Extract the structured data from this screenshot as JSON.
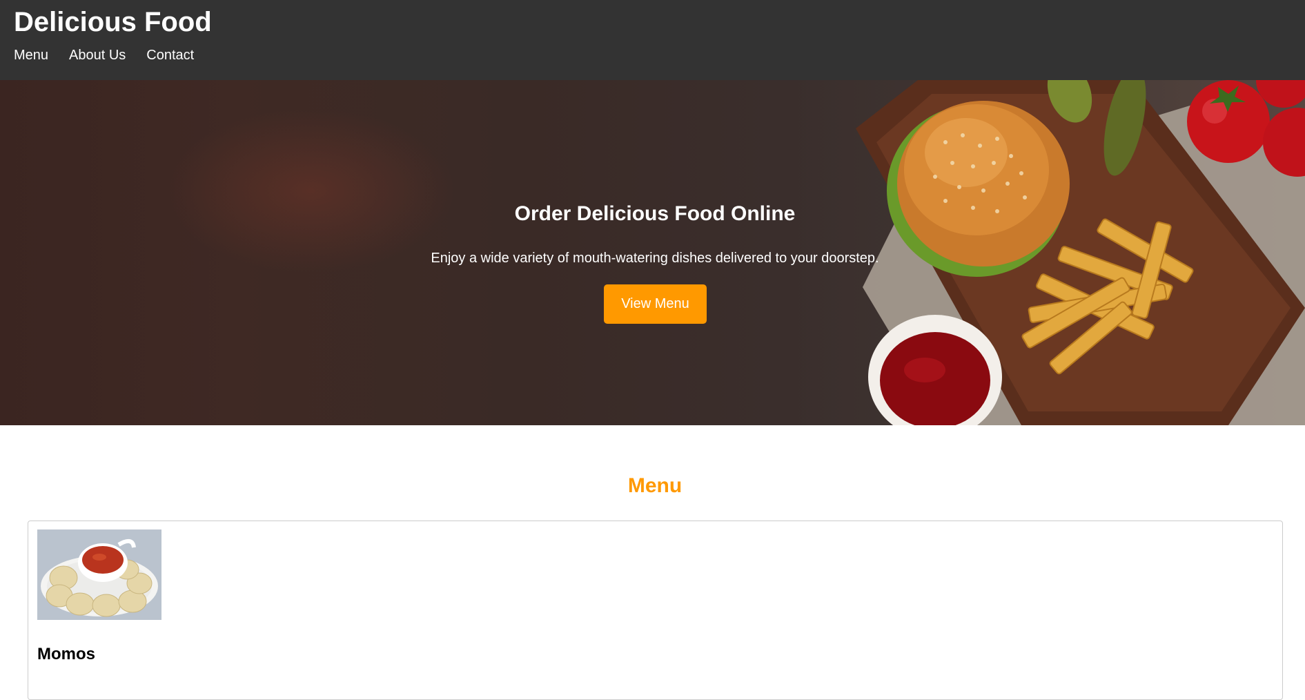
{
  "header": {
    "site_title": "Delicious Food",
    "nav": [
      {
        "label": "Menu"
      },
      {
        "label": "About Us"
      },
      {
        "label": "Contact"
      }
    ]
  },
  "hero": {
    "title": "Order Delicious Food Online",
    "subtitle": "Enjoy a wide variety of mouth-watering dishes delivered to your doorstep.",
    "cta_label": "View Menu"
  },
  "menu": {
    "heading": "Menu",
    "items": [
      {
        "name": "Momos"
      }
    ]
  },
  "colors": {
    "header_bg": "#333333",
    "accent": "#ff9900",
    "text_light": "#ffffff"
  }
}
